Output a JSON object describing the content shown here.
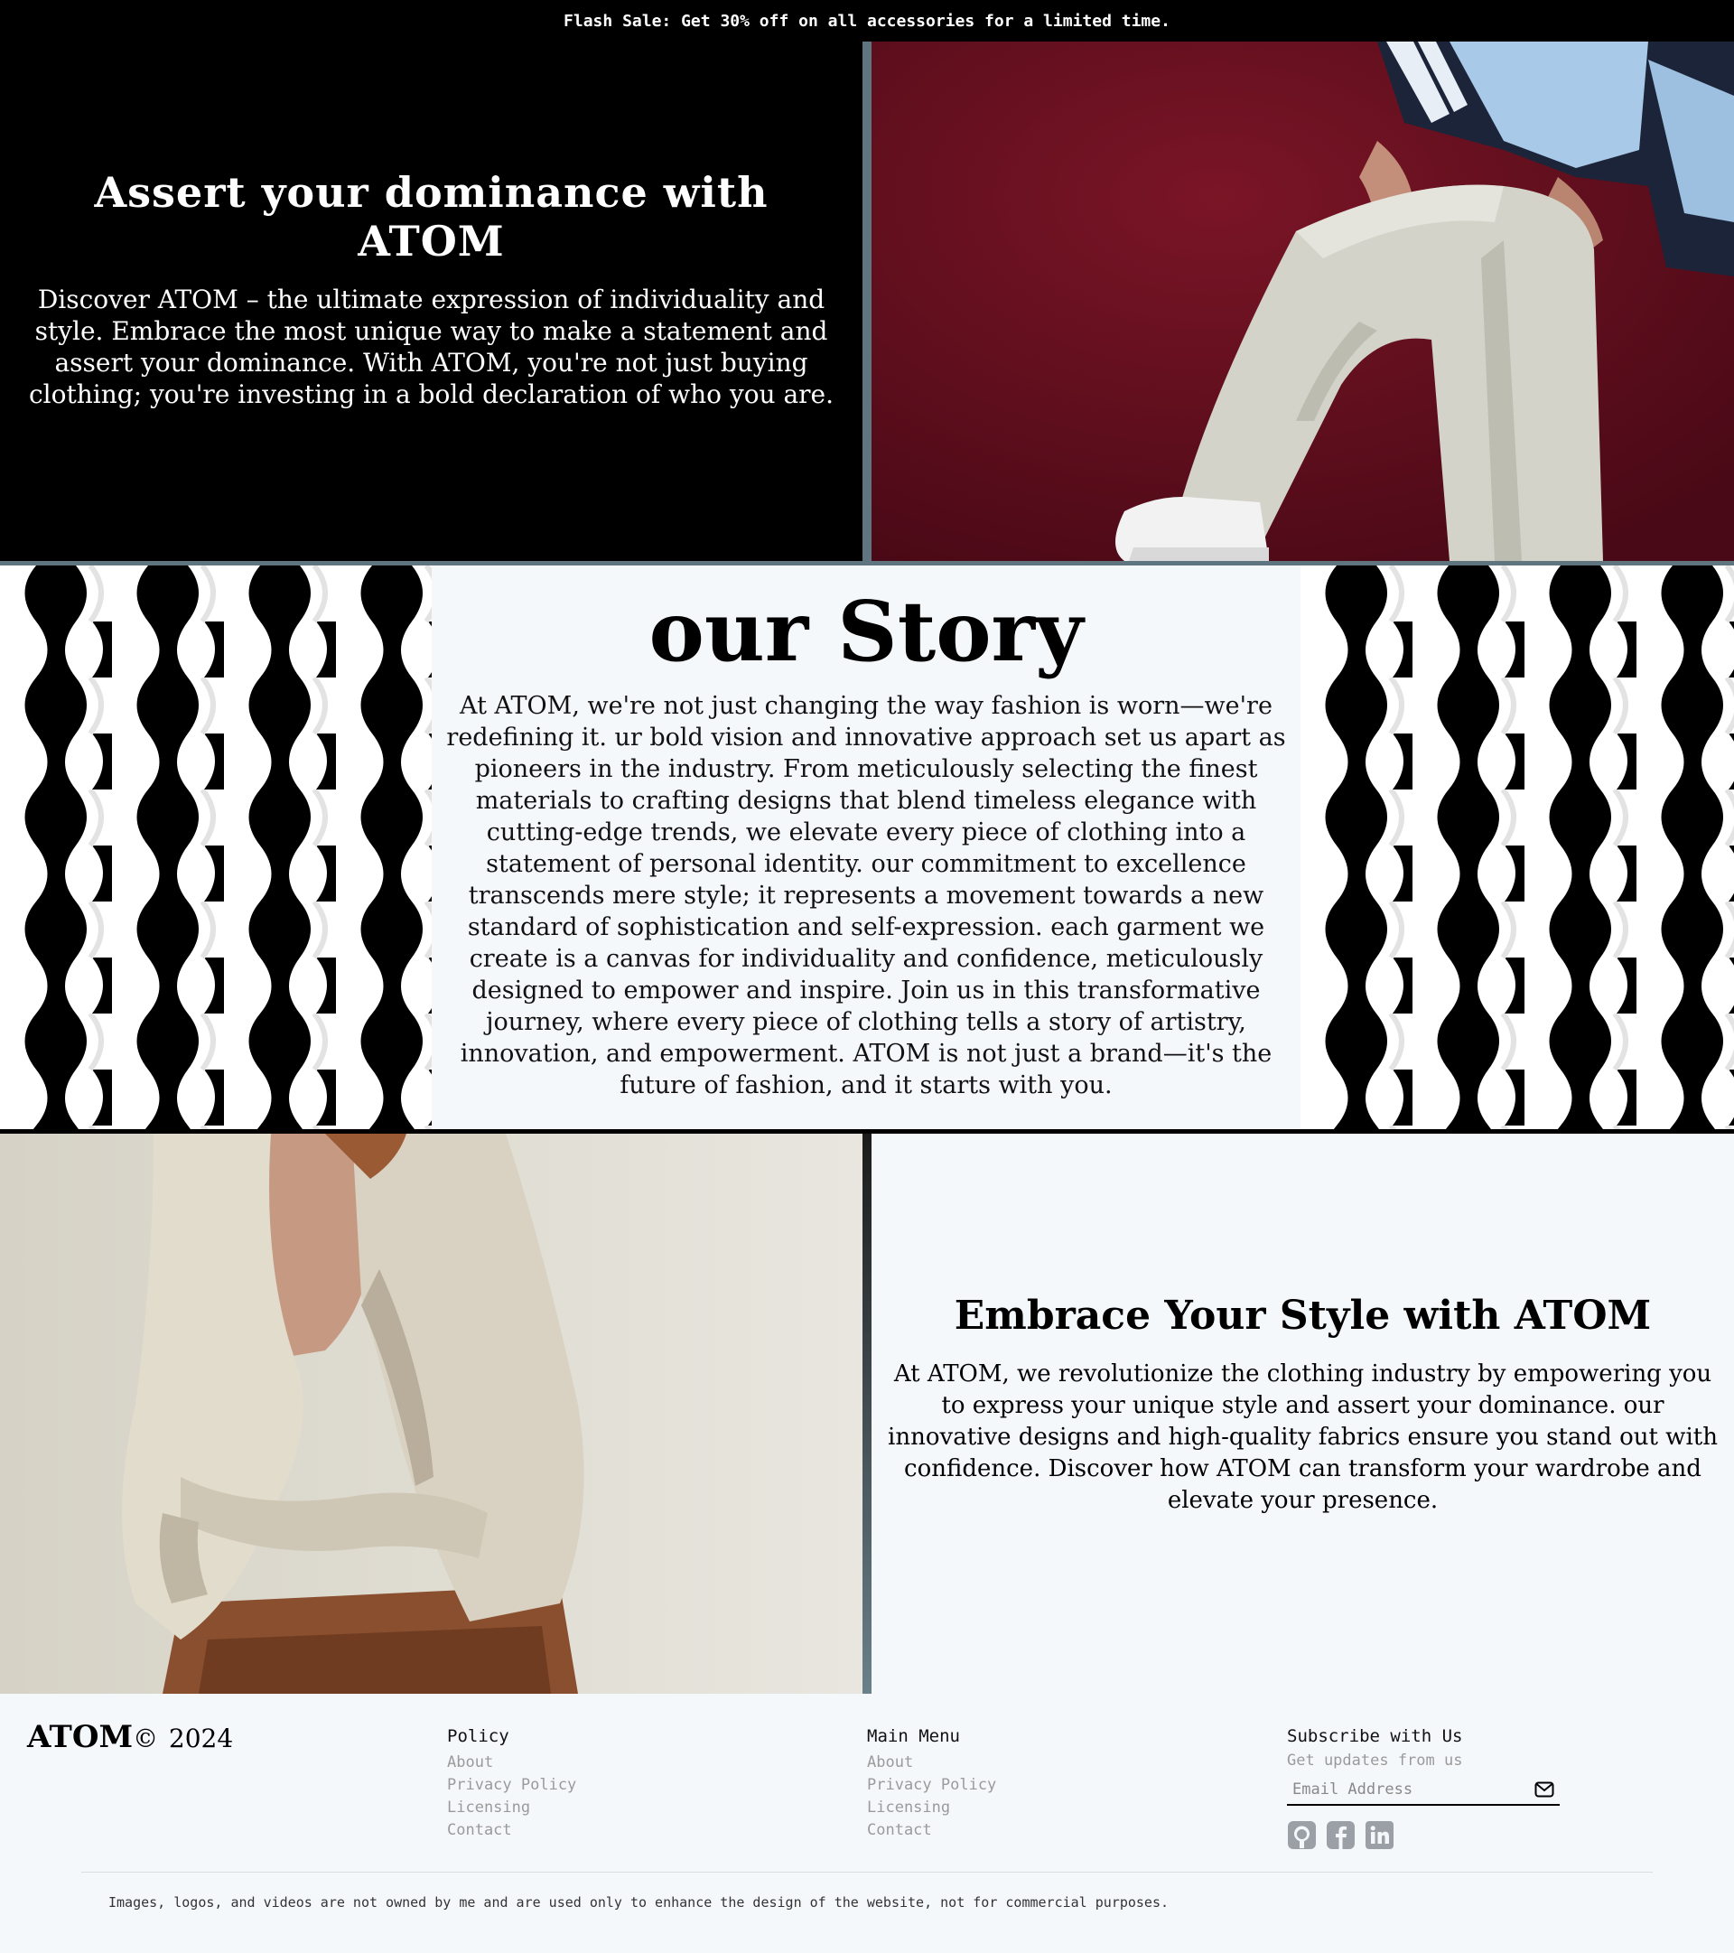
{
  "flash_banner": {
    "text": "Flash Sale: Get 30% off on all accessories for a limited time."
  },
  "hero": {
    "title": "Assert your dominance with ATOM",
    "description": "Discover ATOM – the ultimate expression of individuality and style. Embrace the most unique way to make a statement and assert your dominance. With ATOM, you're not just buying clothing; you're investing in a bold declaration of who you are."
  },
  "story": {
    "title": "our Story",
    "text": "At ATOM, we're not just changing the way fashion is worn—we're redefining it. ur bold vision and innovative approach set us apart as pioneers in the industry. From meticulously selecting the finest materials to crafting designs that blend timeless elegance with cutting-edge trends, we elevate every piece of clothing into a statement of personal identity. our commitment to excellence transcends mere style; it represents a movement towards a new standard of sophistication and self-expression. each garment we create is a canvas for individuality and confidence, meticulously designed to empower and inspire. Join us in this transformative journey, where every piece of clothing tells a story of artistry, innovation, and empowerment. ATOM is not just a brand—it's the future of fashion, and it starts with you."
  },
  "style_section": {
    "title": "Embrace Your Style with ATOM",
    "description": "At ATOM, we revolutionize the clothing industry by empowering you to express your unique style and assert your dominance. our innovative designs and high-quality fabrics ensure you stand out with confidence. Discover how ATOM can transform your wardrobe and elevate your presence."
  },
  "footer": {
    "brand": "ATOM",
    "copyright_symbol": "©",
    "year": "2024",
    "policy": {
      "heading": "Policy",
      "links": [
        "About",
        "Privacy Policy",
        "Licensing",
        "Contact"
      ]
    },
    "main_menu": {
      "heading": "Main Menu",
      "links": [
        "About",
        "Privacy Policy",
        "Licensing",
        "Contact"
      ]
    },
    "subscribe": {
      "heading": "Subscribe with Us",
      "note": "Get updates from us",
      "email_placeholder": "Email Address",
      "submit_icon": "mail-icon",
      "socials": [
        "github-icon",
        "facebook-icon",
        "linkedin-icon"
      ]
    },
    "disclaimer": "Images, logos, and videos are not owned by me and are used only to enhance the design of the website, not for commercial purposes."
  },
  "colors": {
    "banner_bg": "#000000",
    "hero_bg": "#000000",
    "hero_photo_bg": "#5a0c1c",
    "divider": "#5f7680",
    "page_bg": "#f5f8fb",
    "link_gray": "#9a9a9a"
  }
}
